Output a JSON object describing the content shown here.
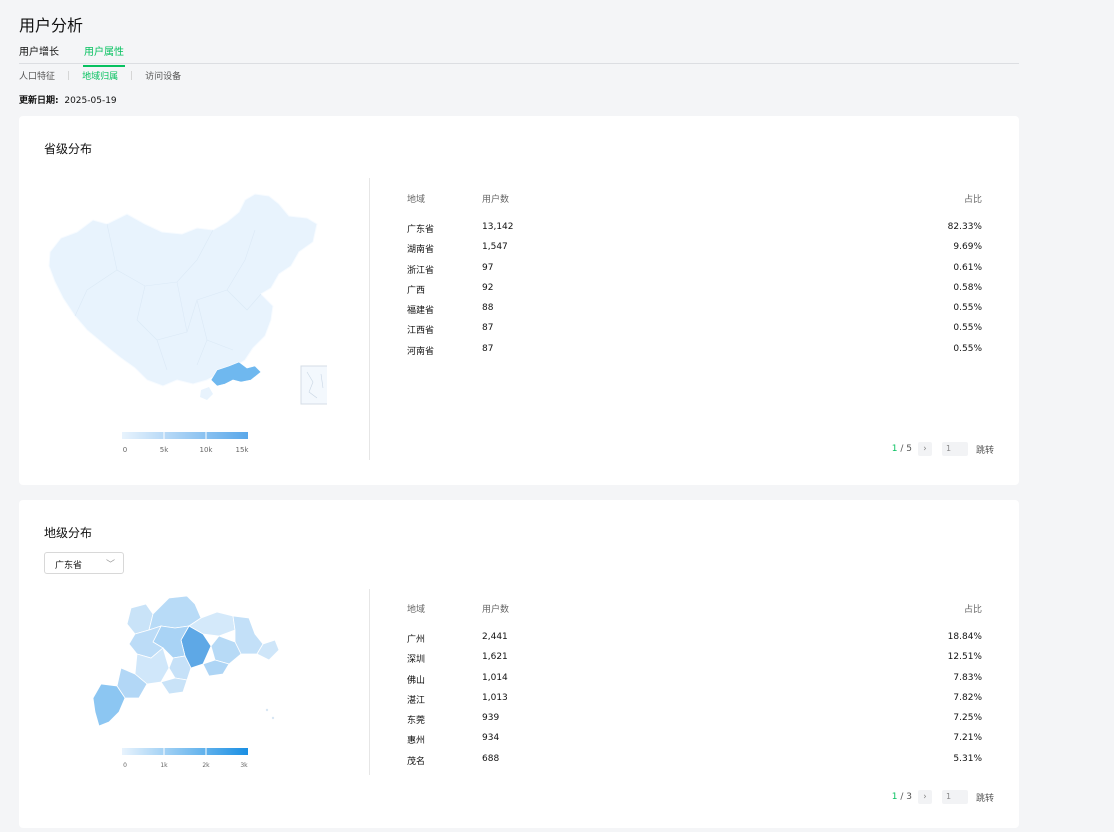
{
  "page": {
    "title": "用户分析",
    "updated_label": "更新日期:",
    "updated_value": "2025-05-19"
  },
  "tabs": [
    {
      "label": "用户增长",
      "active": false
    },
    {
      "label": "用户属性",
      "active": true
    }
  ],
  "subtabs": [
    {
      "label": "人口特征",
      "active": false
    },
    {
      "label": "地域归属",
      "active": true
    },
    {
      "label": "访问设备",
      "active": false
    }
  ],
  "province": {
    "title": "省级分布",
    "headers": {
      "region": "地域",
      "users": "用户数",
      "ratio": "占比"
    },
    "rows": [
      {
        "region": "广东省",
        "users": "13,142",
        "ratio": "82.33%"
      },
      {
        "region": "湖南省",
        "users": "1,547",
        "ratio": "9.69%"
      },
      {
        "region": "浙江省",
        "users": "97",
        "ratio": "0.61%"
      },
      {
        "region": "广西",
        "users": "92",
        "ratio": "0.58%"
      },
      {
        "region": "福建省",
        "users": "88",
        "ratio": "0.55%"
      },
      {
        "region": "江西省",
        "users": "87",
        "ratio": "0.55%"
      },
      {
        "region": "河南省",
        "users": "87",
        "ratio": "0.55%"
      }
    ],
    "legend_ticks": [
      "0",
      "5k",
      "10k",
      "15k"
    ],
    "pager": {
      "current": "1",
      "total": "/ 5",
      "input": "1",
      "jump": "跳转"
    }
  },
  "city": {
    "title": "地级分布",
    "select_value": "广东省",
    "headers": {
      "region": "地域",
      "users": "用户数",
      "ratio": "占比"
    },
    "rows": [
      {
        "region": "广州",
        "users": "2,441",
        "ratio": "18.84%"
      },
      {
        "region": "深圳",
        "users": "1,621",
        "ratio": "12.51%"
      },
      {
        "region": "佛山",
        "users": "1,014",
        "ratio": "7.83%"
      },
      {
        "region": "湛江",
        "users": "1,013",
        "ratio": "7.82%"
      },
      {
        "region": "东莞",
        "users": "939",
        "ratio": "7.25%"
      },
      {
        "region": "惠州",
        "users": "934",
        "ratio": "7.21%"
      },
      {
        "region": "茂名",
        "users": "688",
        "ratio": "5.31%"
      }
    ],
    "legend_ticks": [
      "0",
      "1k",
      "2k",
      "3k"
    ],
    "pager": {
      "current": "1",
      "total": "/ 3",
      "input": "1",
      "jump": "跳转"
    }
  },
  "colors": {
    "accent": "#07c160",
    "map_low": "#e8f3fd",
    "map_high": "#1a8fe3",
    "guangdong": "#6fb8ef"
  },
  "icons": {
    "next": "chevron-right-icon",
    "select": "chevron-down-icon"
  }
}
